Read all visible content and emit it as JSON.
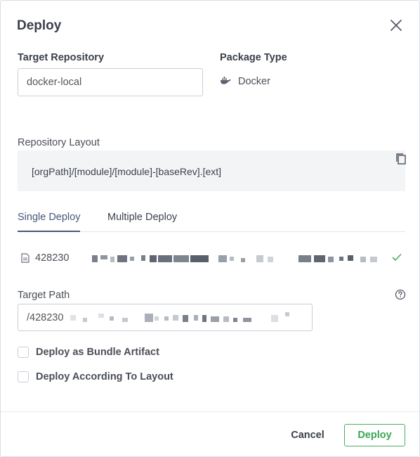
{
  "dialog": {
    "title": "Deploy",
    "close_icon": "close-icon"
  },
  "target_repository": {
    "label": "Target Repository",
    "value": "docker-local"
  },
  "package_type": {
    "label": "Package Type",
    "icon": "docker-icon",
    "value": "Docker"
  },
  "repository_layout": {
    "label": "Repository Layout",
    "value": "[orgPath]/[module]/[module]-[baseRev].[ext]",
    "copy_icon": "copy-icon"
  },
  "tabs": [
    {
      "label": "Single Deploy",
      "active": true
    },
    {
      "label": "Multiple Deploy",
      "active": false
    }
  ],
  "file": {
    "icon": "file-icon",
    "name_prefix": "428230",
    "status_icon": "check-icon"
  },
  "target_path": {
    "label": "Target Path",
    "value_prefix": "/428230",
    "help_icon": "help-circle-icon"
  },
  "options": [
    {
      "label": "Deploy as Bundle Artifact",
      "checked": false
    },
    {
      "label": "Deploy According To Layout",
      "checked": false
    }
  ],
  "footer": {
    "cancel_label": "Cancel",
    "deploy_label": "Deploy"
  },
  "colors": {
    "accent": "#43587a",
    "success": "#4cad5f"
  }
}
